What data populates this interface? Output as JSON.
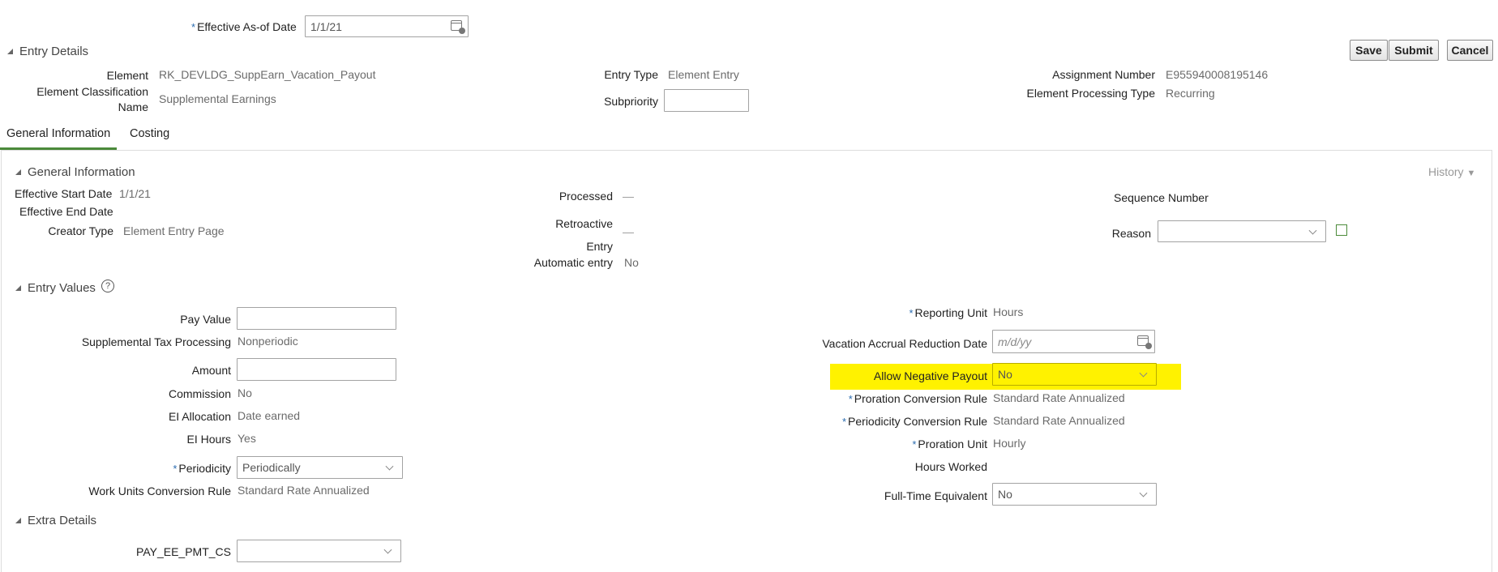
{
  "header": {
    "effective_label": "Effective As-of Date",
    "effective_value": "1/1/21"
  },
  "entry_details": {
    "title": "Entry Details",
    "element_label": "Element",
    "element_value": "RK_DEVLDG_SuppEarn_Vacation_Payout",
    "classification_label_1": "Element Classification",
    "classification_label_2": "Name",
    "classification_value": "Supplemental Earnings",
    "entry_type_label": "Entry Type",
    "entry_type_value": "Element Entry",
    "subpriority_label": "Subpriority",
    "subpriority_value": "",
    "assignment_label": "Assignment Number",
    "assignment_value": "E955940008195146",
    "processing_type_label": "Element Processing Type",
    "processing_type_value": "Recurring"
  },
  "buttons": {
    "save": "Save",
    "submit": "Submit",
    "cancel": "Cancel"
  },
  "tabs": [
    {
      "label": "General Information",
      "active": true
    },
    {
      "label": "Costing",
      "active": false
    }
  ],
  "general_info": {
    "title": "General Information",
    "history": "History",
    "start_date_label": "Effective Start Date",
    "start_date_value": "1/1/21",
    "end_date_label": "Effective End Date",
    "creator_type_label": "Creator Type",
    "creator_type_value": "Element Entry Page",
    "processed_label": "Processed",
    "processed_value": "—",
    "retro_label_1": "Retroactive",
    "retro_label_2": "Entry",
    "retro_value": "—",
    "auto_entry_label": "Automatic entry",
    "auto_entry_value": "No",
    "sequence_label": "Sequence Number",
    "reason_label": "Reason",
    "reason_value": ""
  },
  "entry_values": {
    "title": "Entry Values",
    "pay_value_label": "Pay Value",
    "pay_value": "",
    "supp_tax_label": "Supplemental Tax Processing",
    "supp_tax_value": "Nonperiodic",
    "amount_label": "Amount",
    "amount_value": "",
    "commission_label": "Commission",
    "commission_value": "No",
    "ei_alloc_label": "EI Allocation",
    "ei_alloc_value": "Date earned",
    "ei_hours_label": "EI Hours",
    "ei_hours_value": "Yes",
    "periodicity_label": "Periodicity",
    "periodicity_value": "Periodically",
    "work_units_label": "Work Units Conversion Rule",
    "work_units_value": "Standard Rate Annualized",
    "reporting_unit_label": "Reporting Unit",
    "reporting_unit_value": "Hours",
    "vac_accrual_label": "Vacation Accrual Reduction Date",
    "vac_accrual_placeholder": "m/d/yy",
    "allow_neg_label": "Allow Negative Payout",
    "allow_neg_value": "No",
    "proration_label": "Proration Conversion Rule",
    "proration_value": "Standard Rate Annualized",
    "periodicity_conv_label": "Periodicity Conversion Rule",
    "periodicity_conv_value": "Standard Rate Annualized",
    "proration_unit_label": "Proration Unit",
    "proration_unit_value": "Hourly",
    "hours_worked_label": "Hours Worked",
    "fte_label": "Full-Time Equivalent",
    "fte_value": "No"
  },
  "extra_details": {
    "title": "Extra Details",
    "pmt_label": "PAY_EE_PMT_CS",
    "pmt_value": ""
  },
  "colors": {
    "highlight": "#fff200",
    "tab_underline": "#4b8a3a",
    "required_star": "#2b6cb0"
  }
}
